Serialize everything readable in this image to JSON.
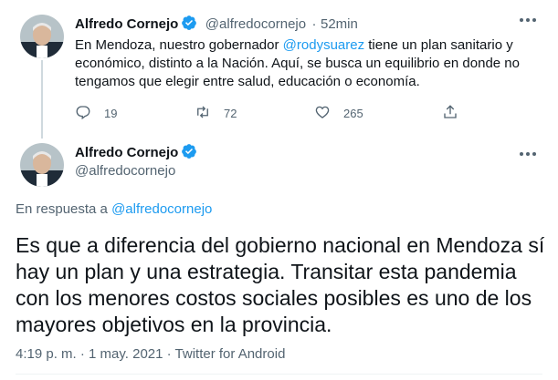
{
  "tweet1": {
    "author_name": "Alfredo Cornejo",
    "handle": "@alfredocornejo",
    "separator": "·",
    "time": "52min",
    "text_before": "En Mendoza, nuestro gobernador ",
    "mention": "@rodysuarez",
    "text_after": " tiene un plan sanitario y económico, distinto a la Nación. Aquí, se busca un equilibrio en donde no tengamos que elegir entre salud, educación o economía.",
    "reply_count": "19",
    "retweet_count": "72",
    "like_count": "265"
  },
  "tweet2": {
    "author_name": "Alfredo Cornejo",
    "handle": "@alfredocornejo",
    "reply_prefix": "En respuesta a ",
    "reply_to": "@alfredocornejo",
    "text": "Es que a diferencia del gobierno nacional en Mendoza sí hay un plan y una estrategia. Transitar esta pandemia con los menores costos sociales posibles es uno de los mayores objetivos en la provincia.",
    "timestamp": "4:19 p. m. · 1 may. 2021 · Twitter for Android"
  },
  "colors": {
    "accent": "#1d9bf0",
    "secondary_text": "#536471",
    "primary_text": "#0f1419"
  }
}
